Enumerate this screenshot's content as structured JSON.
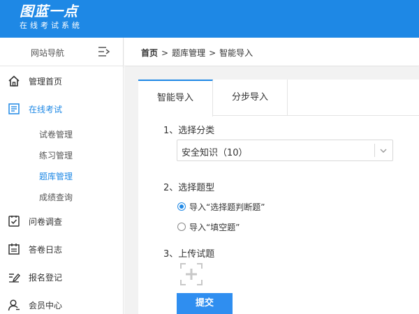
{
  "brand": {
    "title": "图蓝一点",
    "subtitle": "在线考试系统"
  },
  "sidebar": {
    "header": "网站导航",
    "items": [
      {
        "label": "管理首页",
        "icon": "home-icon"
      },
      {
        "label": "在线考试",
        "icon": "exam-list-icon",
        "active": true,
        "children": [
          {
            "label": "试卷管理"
          },
          {
            "label": "练习管理"
          },
          {
            "label": "题库管理",
            "active": true
          },
          {
            "label": "成绩查询"
          }
        ]
      },
      {
        "label": "问卷调查",
        "icon": "survey-check-icon"
      },
      {
        "label": "答卷日志",
        "icon": "log-calendar-icon"
      },
      {
        "label": "报名登记",
        "icon": "sign-pen-icon"
      },
      {
        "label": "会员中心",
        "icon": "user-icon"
      }
    ]
  },
  "breadcrumb": {
    "home": "首页",
    "level1": "题库管理",
    "current": "智能导入",
    "separator": ">"
  },
  "tabs": [
    {
      "label": "智能导入",
      "active": true
    },
    {
      "label": "分步导入"
    }
  ],
  "form": {
    "step1": {
      "label": "1、选择分类",
      "selected": "安全知识（10）"
    },
    "step2": {
      "label": "2、选择题型",
      "options": [
        {
          "label": "导入“选择题判断题”",
          "checked": true
        },
        {
          "label": "导入“填空题”",
          "checked": false
        }
      ]
    },
    "step3": {
      "label": "3、上传试题"
    },
    "submit_label": "提交"
  },
  "colors": {
    "brand_blue": "#1e88e5",
    "button_blue": "#2f8ef0",
    "content_bg": "#f2f2f2"
  }
}
